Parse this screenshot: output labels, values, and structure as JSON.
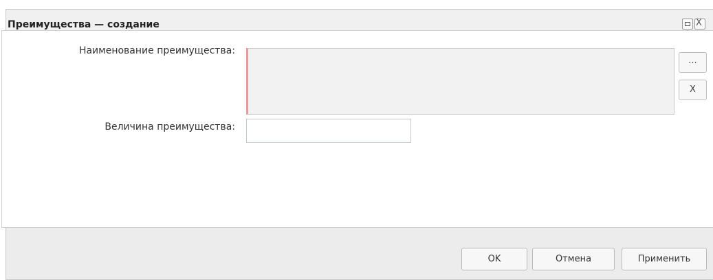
{
  "window": {
    "title": "Преимущества — создание"
  },
  "titlebar_buttons": {
    "maximize_icon": "maximize-icon",
    "close_glyph": "X"
  },
  "form": {
    "name_label": "Наименование преимущества:",
    "name_value": "",
    "value_label": "Величина преимущества:",
    "value_value": "",
    "pick_button": "...",
    "clear_button": "X",
    "required_marker_color": "#e79a9a"
  },
  "footer": {
    "ok": "OK",
    "cancel": "Отмена",
    "apply": "Применить"
  }
}
